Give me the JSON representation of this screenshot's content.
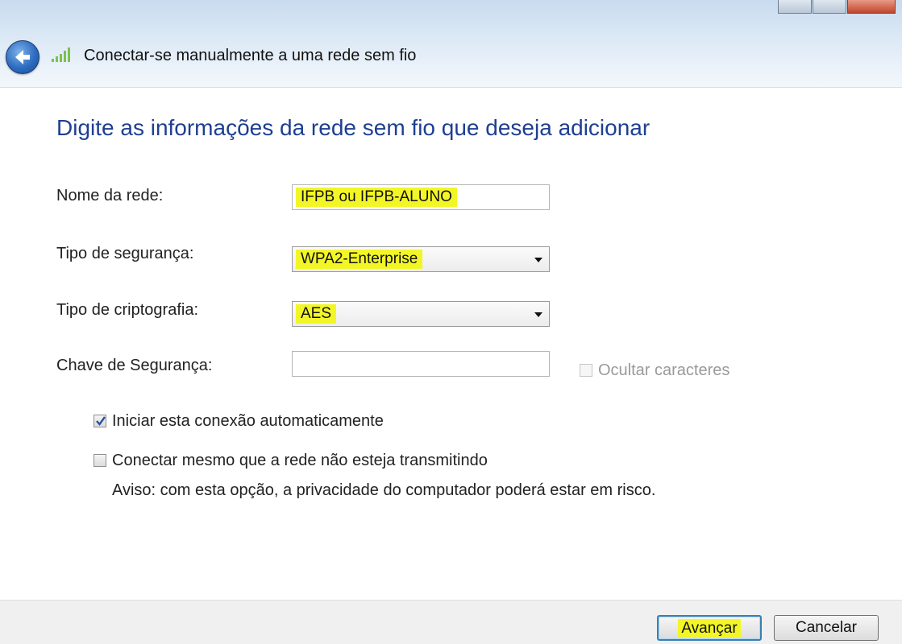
{
  "window": {
    "title": "Conectar-se manualmente a uma rede sem fio",
    "icons": [
      "back-arrow-icon",
      "wifi-signal-icon"
    ]
  },
  "main": {
    "heading": "Digite as informações da rede sem fio que deseja adicionar",
    "network_name": {
      "label": "Nome da rede:",
      "value": "IFPB ou IFPB-ALUNO"
    },
    "security_type": {
      "label": "Tipo de segurança:",
      "value": "WPA2-Enterprise"
    },
    "encryption_type": {
      "label": "Tipo de criptografia:",
      "value": "AES"
    },
    "security_key": {
      "label": "Chave de Segurança:",
      "value": ""
    },
    "hide_chars": {
      "label": "Ocultar caracteres",
      "checked": false,
      "enabled": false
    },
    "auto_connect": {
      "label": "Iniciar esta conexão automaticamente",
      "checked": true
    },
    "connect_hidden": {
      "label": "Conectar mesmo que a rede não esteja transmitindo",
      "checked": false
    },
    "warning": "Aviso: com esta opção, a privacidade do computador poderá estar em risco."
  },
  "footer": {
    "next_label": "Avançar",
    "cancel_label": "Cancelar"
  },
  "colors": {
    "heading": "#1e3f91",
    "highlight": "#f3f626",
    "titlebar": "#d8e6f4"
  }
}
